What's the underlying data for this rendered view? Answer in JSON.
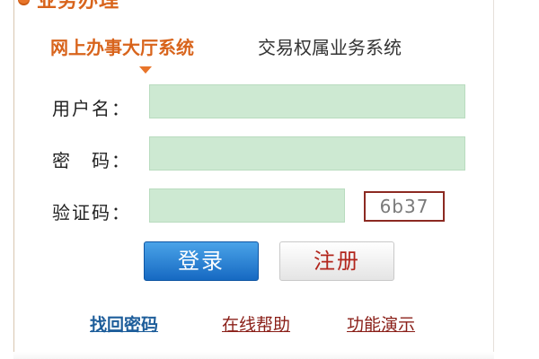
{
  "section": {
    "title": "业务办理"
  },
  "tabs": [
    {
      "label": "网上办事大厅系统",
      "active": true
    },
    {
      "label": "交易权属业务系统",
      "active": false
    }
  ],
  "form": {
    "username_label": "用户名：",
    "username_value": "",
    "password_label": "密　码：",
    "password_value": "",
    "captcha_label": "验证码：",
    "captcha_value": "",
    "captcha_code": "6b37"
  },
  "buttons": {
    "login": "登录",
    "register": "注册"
  },
  "links": {
    "forgot_password": "找回密码",
    "online_help": "在线帮助",
    "feature_demo": "功能演示"
  },
  "colors": {
    "accent_orange": "#d8641c",
    "input_green": "#cde9d2",
    "login_blue": "#1669c2",
    "register_red": "#b2261d",
    "link_blue": "#1d5d9a",
    "link_red": "#8a1f18"
  }
}
